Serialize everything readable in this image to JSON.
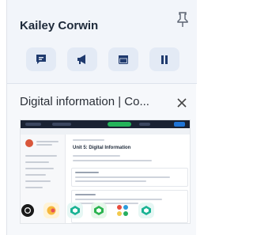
{
  "contact": {
    "name": "Kailey Corwin"
  },
  "actions": [
    {
      "name": "chat-icon"
    },
    {
      "name": "announce-icon"
    },
    {
      "name": "window-icon"
    },
    {
      "name": "pause-icon"
    }
  ],
  "tab": {
    "title": "Digital information | Co..."
  },
  "preview": {
    "heading": "Unit 5: Digital Information"
  },
  "dock": [
    {
      "name": "chrome-icon"
    },
    {
      "name": "app-icon-yellow"
    },
    {
      "name": "app-icon-teal"
    },
    {
      "name": "app-icon-green"
    },
    {
      "name": "app-icon-multicolor"
    },
    {
      "name": "app-icon-teal-2"
    }
  ],
  "colors": {
    "accent": "#1f3a6e",
    "action_bg": "#e3eaf5",
    "card_bg": "#f6f8fb"
  }
}
